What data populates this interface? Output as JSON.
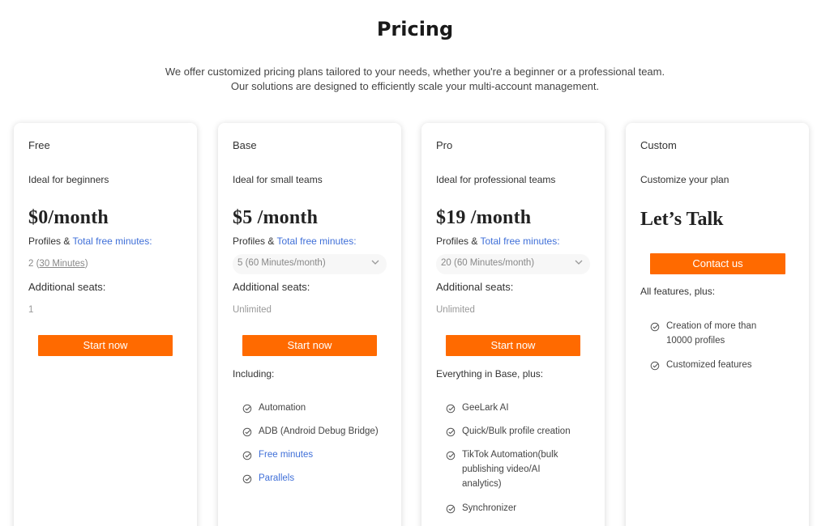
{
  "header": {
    "title": "Pricing",
    "subtitle_line1": "We offer customized pricing plans tailored to your needs, whether you're a beginner or a professional team.",
    "subtitle_line2": "Our solutions are designed to efficiently scale your multi-account management."
  },
  "colors": {
    "accent": "#ff6a00",
    "link": "#3f6fd8"
  },
  "plans": {
    "free": {
      "name": "Free",
      "desc": "Ideal for beginners",
      "price": "$0/month",
      "profiles_label": "Profiles &",
      "profiles_link": "Total free minutes:",
      "profile_value_prefix": "2 (",
      "profile_value_link": "30 Minutes",
      "profile_value_suffix": ")",
      "seats_label": "Additional seats:",
      "seats_value": "1",
      "cta": "Start now"
    },
    "base": {
      "name": "Base",
      "desc": "Ideal for small teams",
      "price": "$5 /month",
      "profiles_label": "Profiles &",
      "profiles_link": "Total free minutes:",
      "profile_select": "5 (60 Minutes/month)",
      "seats_label": "Additional seats:",
      "seats_value": "Unlimited",
      "cta": "Start now",
      "including": "Including:",
      "features": [
        "Automation",
        "ADB (Android Debug Bridge)",
        "Free minutes",
        "Parallels"
      ]
    },
    "pro": {
      "name": "Pro",
      "desc": "Ideal for professional teams",
      "price": "$19 /month",
      "profiles_label": "Profiles &",
      "profiles_link": "Total free minutes:",
      "profile_select": "20 (60 Minutes/month)",
      "seats_label": "Additional seats:",
      "seats_value": "Unlimited",
      "cta": "Start now",
      "including": "Everything in Base, plus:",
      "features": [
        "GeeLark AI",
        "Quick/Bulk profile creation",
        "TikTok Automation(bulk",
        "publishing video/AI",
        "analytics)",
        "Synchronizer"
      ]
    },
    "custom": {
      "name": "Custom",
      "desc": "Customize your plan",
      "price": "Let’s Talk",
      "cta": "Contact us",
      "all_features": "All features, plus:",
      "features": [
        "Creation of more than",
        "10000 profiles",
        "Customized features"
      ]
    }
  },
  "icons": {
    "check": "check-circle-icon",
    "chevron": "chevron-down-icon"
  }
}
